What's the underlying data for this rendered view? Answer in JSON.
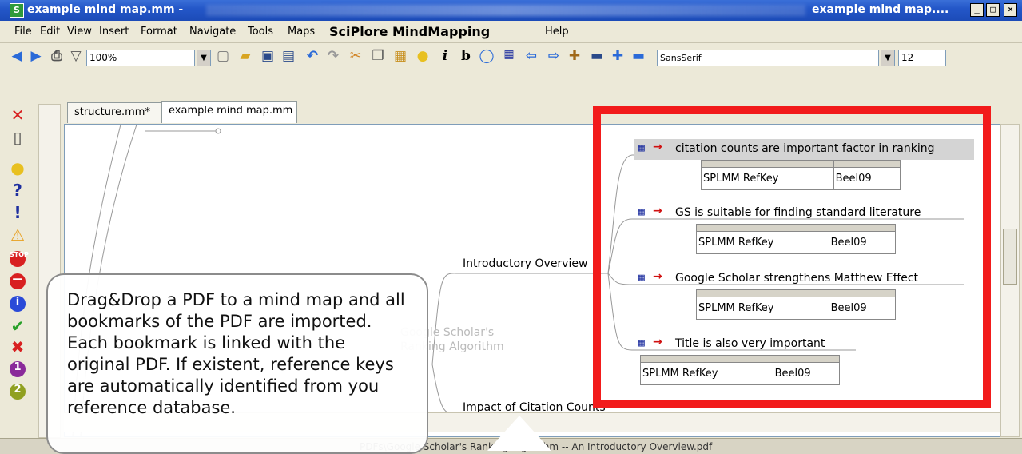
{
  "window": {
    "title": "example mind map.mm -",
    "title_right": "example mind map....",
    "app_logo": "S",
    "min_label": "_",
    "max_label": "□",
    "close_label": "×"
  },
  "menu": {
    "items": [
      "File",
      "Edit",
      "View",
      "Insert",
      "Format",
      "Navigate",
      "Tools",
      "Maps",
      "SciPlore MindMapping",
      "Help"
    ]
  },
  "toolbar": {
    "zoom_value": "100%",
    "font_name": "SansSerif",
    "font_size": "12",
    "icons": [
      "back-icon",
      "forward-icon",
      "print-icon",
      "filter-icon",
      "new-icon",
      "open-icon",
      "save-icon",
      "save-as-icon",
      "undo-icon",
      "redo-icon",
      "cut-icon",
      "copy-icon",
      "paste-icon",
      "idea-icon",
      "italic-icon",
      "bold-icon",
      "note-icon",
      "table-icon",
      "left-arrow-icon",
      "right-arrow-icon",
      "expand-icon",
      "collapse-icon",
      "add-icon",
      "remove-icon"
    ],
    "italic_glyph": "i",
    "bold_glyph": "b"
  },
  "tabs": [
    {
      "label": "structure.mm*",
      "active": false
    },
    {
      "label": "example mind map.mm",
      "active": true
    }
  ],
  "mindmap": {
    "branch_introductory": "Introductory Overview",
    "branch_impact": "Impact of Citation Counts",
    "nodes": [
      {
        "text": "citation counts are important factor in ranking",
        "attr_key": "SPLMM RefKey",
        "attr_value": "Beel09"
      },
      {
        "text": "GS is suitable for finding standard literature",
        "attr_key": "SPLMM RefKey",
        "attr_value": "Beel09"
      },
      {
        "text": "Google Scholar strengthens Matthew Effect",
        "attr_key": "SPLMM RefKey",
        "attr_value": "Beel09"
      },
      {
        "text": "Title is also very important",
        "attr_key": "SPLMM RefKey",
        "attr_value": "Beel09"
      }
    ],
    "ghost_text_1": "Google Scholar's",
    "ghost_text_2": "Ranking Algorithm"
  },
  "callout": {
    "text": "Drag&Drop a PDF to a mind map and all bookmarks of the PDF are imported. Each bookmark is linked with the original PDF. If existent, reference keys are automatically identified from you reference database."
  },
  "statusbar": {
    "path": "PDFs\\Google Scholar's Ranking Algorithm -- An Introductory Overview.pdf"
  },
  "colors": {
    "highlight_box": "#f21b1b",
    "titlebar": "#2457c8",
    "node_arrow": "#d01010"
  }
}
